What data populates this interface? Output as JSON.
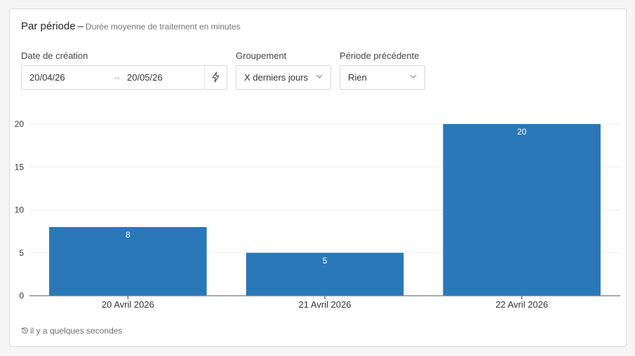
{
  "header": {
    "title": "Par période",
    "separator": "–",
    "subtitle": "Durée moyenne de traitement en minutes"
  },
  "filters": {
    "date_label": "Date de création",
    "date_start": "20/04/26",
    "date_end": "20/05/26",
    "grouping_label": "Groupement",
    "grouping_value": "X derniers jours",
    "previous_label": "Période précédente",
    "previous_value": "Rien"
  },
  "chart_data": {
    "type": "bar",
    "categories": [
      "20 Avril 2026",
      "21 Avril 2026",
      "22 Avril 2026"
    ],
    "values": [
      8,
      5,
      20
    ],
    "data_labels": [
      "8",
      "5",
      "20"
    ],
    "title": "",
    "xlabel": "",
    "ylabel": "",
    "ylim": [
      0,
      20
    ],
    "yticks": [
      0,
      5,
      10,
      15,
      20
    ],
    "grid": true,
    "bar_color": "#2a78b7"
  },
  "footer": {
    "updated": "il y a quelques secondes"
  },
  "colors": {
    "bar": "#2a78b7",
    "grid": "#eeeeee",
    "axis": "#333333"
  }
}
